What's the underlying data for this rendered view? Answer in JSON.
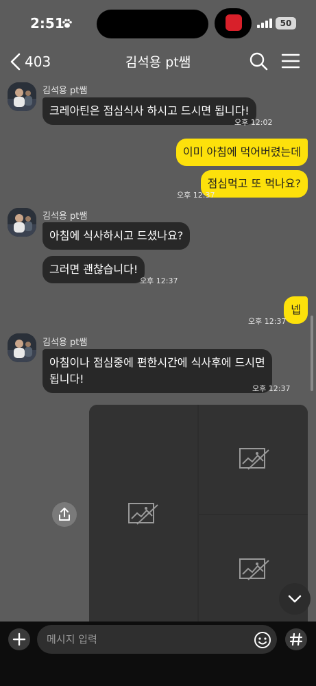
{
  "status_bar": {
    "time": "2:51",
    "battery": "50"
  },
  "header": {
    "back_count": "403",
    "title": "김석용 pt쌤"
  },
  "messages": [
    {
      "sender": "김석용 pt쌤",
      "text": "크레아틴은 점심식사 하시고 드시면 됩니다!",
      "time": "오후 12:02"
    },
    {
      "text": "이미 아침에 먹어버렸는데"
    },
    {
      "text": "점심먹고 또 먹나요?",
      "time": "오후 12:37"
    },
    {
      "sender": "김석용 pt쌤",
      "text": "아침에 식사하시고 드셨나요?"
    },
    {
      "text": "그러면 괜찮습니다!",
      "time": "오후 12:37"
    },
    {
      "text": "넵",
      "time": "오후 12:37"
    },
    {
      "sender": "김석용 pt쌤",
      "text_line1": "아침이나 점심중에 편한시간에 식사후에 드시면",
      "text_line2": "됩니다!",
      "time": "오후 12:37"
    }
  ],
  "input": {
    "placeholder": "메시지 입력"
  },
  "icons": {
    "back": "chevron-left-icon",
    "search": "search-icon",
    "menu": "hamburger-menu-icon",
    "share": "share-icon",
    "scroll_down": "chevron-down-icon",
    "plus": "plus-icon",
    "emoji": "emoji-icon",
    "hash": "hash-icon",
    "image_placeholder": "broken-image-icon"
  },
  "colors": {
    "background": "#5c5c5c",
    "incoming_bubble": "#282828",
    "outgoing_bubble": "#fde10b"
  }
}
